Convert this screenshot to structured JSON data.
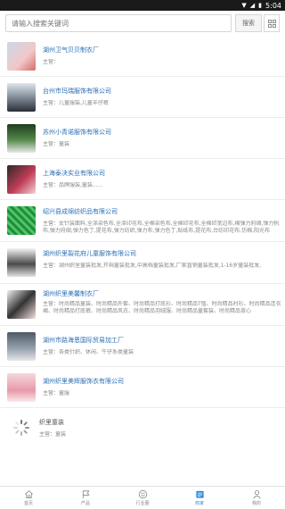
{
  "status": {
    "time": "5:04"
  },
  "search": {
    "placeholder": "请输入搜索关键词",
    "button_label": "搜索"
  },
  "list": [
    {
      "name": "湖州卫气贝贝制衣厂",
      "desc": "主营："
    },
    {
      "name": "台州市玛瑞服饰有限公司",
      "desc": "主营：儿童服装,儿童羊仔裤"
    },
    {
      "name": "苏州小青诺服饰有限公司",
      "desc": "主营：童装"
    },
    {
      "name": "上海泰决实业有限公司",
      "desc": "主营：品牌服装,童装......"
    },
    {
      "name": "绍兴县成绵纺织品有限公司",
      "desc": "主营：女针装面料,全涤染色布,全涤印花布,全棉染色布,全棉印花布,全棉印宽边布,棉弹力府绸,弹力帆布,弹力府绸,弹力色丁,提花布,弹力纺织,弹力布,弹力色丁,贴纸布,提花布,台纺印花布,仿棉,阳光布"
    },
    {
      "name": "湖州织里裂花府儿童服饰有限公司",
      "desc": "主营：湖州织里童装批发,开裆童装批发,中高档童装批发,厂家直销童装批发,1-16岁童装批发,"
    },
    {
      "name": "湖州织里美馨制衣厂",
      "desc": "主营：时尚精品童装、时尚精品外套、时尚精品打底衫、时尚精品T恤、时尚精品衬衫、时尚精品连衣裙、时尚精品打底裤、时尚精品风衣、时尚精品羽绒服、时尚精品童套装、时尚精品背心"
    },
    {
      "name": "湖州市路海恩国际贸易加工厂",
      "desc": "主营：各类针织、休闲、牛仔系类童装"
    },
    {
      "name": "湖州织里美辉服饰衣有限公司",
      "desc": "主营：童服"
    },
    {
      "name": "织里童装",
      "desc": "主营：童装"
    }
  ],
  "tabs": [
    {
      "label": "首页",
      "icon": "home-icon"
    },
    {
      "label": "产品",
      "icon": "flag-icon"
    },
    {
      "label": "行业圈",
      "icon": "smile-icon"
    },
    {
      "label": "商家",
      "icon": "shop-icon"
    },
    {
      "label": "我的",
      "icon": "user-icon"
    }
  ],
  "colors": {
    "link": "#2a6fb4",
    "active_tab": "#2a8bd6"
  }
}
